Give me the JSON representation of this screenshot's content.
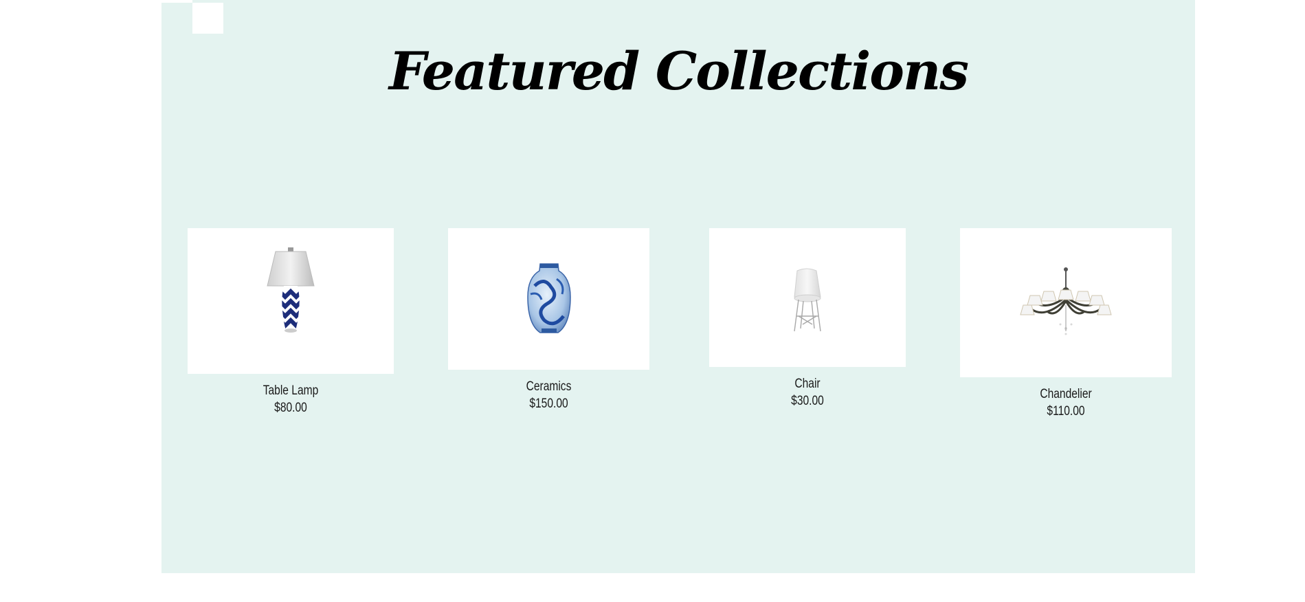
{
  "section": {
    "title": "Featured Collections"
  },
  "colors": {
    "panel_background": "#e4f3f0",
    "card_background": "#ffffff",
    "text": "#000000"
  },
  "products": [
    {
      "name": "Table Lamp",
      "price": "$80.00",
      "image": "table-lamp-image"
    },
    {
      "name": "Ceramics",
      "price": "$150.00",
      "image": "ceramic-vase-image"
    },
    {
      "name": "Chair",
      "price": "$30.00",
      "image": "chair-image"
    },
    {
      "name": "Chandelier",
      "price": "$110.00",
      "image": "chandelier-image"
    }
  ]
}
